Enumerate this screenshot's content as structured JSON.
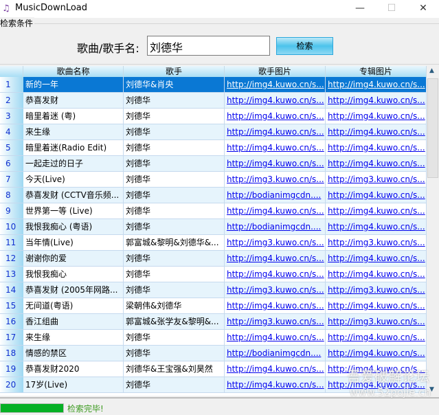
{
  "window": {
    "title": "MusicDownLoad",
    "minimize": "—",
    "maximize": "☐",
    "close": "✕"
  },
  "search": {
    "group_label": "检索条件",
    "label": "歌曲/歌手名:",
    "value": "刘德华",
    "button": "检索"
  },
  "table": {
    "columns": [
      "歌曲名称",
      "歌手",
      "歌手图片",
      "专辑图片"
    ],
    "selected_row": 1,
    "rows": [
      {
        "n": "1",
        "name": "新的一年",
        "artist": "刘德华&肖央",
        "singer_img": "http://img4.kuwo.cn/s...",
        "album_img": "http://img4.kuwo.cn/s..."
      },
      {
        "n": "2",
        "name": "恭喜发财",
        "artist": "刘德华",
        "singer_img": "http://img4.kuwo.cn/s...",
        "album_img": "http://img4.kuwo.cn/s..."
      },
      {
        "n": "3",
        "name": "暗里着迷 (粤)",
        "artist": "刘德华",
        "singer_img": "http://img4.kuwo.cn/s...",
        "album_img": "http://img4.kuwo.cn/s..."
      },
      {
        "n": "4",
        "name": "来生缘",
        "artist": "刘德华",
        "singer_img": "http://img4.kuwo.cn/s...",
        "album_img": "http://img4.kuwo.cn/s..."
      },
      {
        "n": "5",
        "name": "暗里着迷(Radio Edit)",
        "artist": "刘德华",
        "singer_img": "http://img4.kuwo.cn/s...",
        "album_img": "http://img4.kuwo.cn/s..."
      },
      {
        "n": "6",
        "name": "一起走过的日子",
        "artist": "刘德华",
        "singer_img": "http://img4.kuwo.cn/s...",
        "album_img": "http://img4.kuwo.cn/s..."
      },
      {
        "n": "7",
        "name": "今天(Live)",
        "artist": "刘德华",
        "singer_img": "http://img3.kuwo.cn/s...",
        "album_img": "http://img3.kuwo.cn/s..."
      },
      {
        "n": "8",
        "name": "恭喜发财 (CCTV音乐频...",
        "artist": "刘德华",
        "singer_img": "http://bodianimgcdn....",
        "album_img": "http://img4.kuwo.cn/s..."
      },
      {
        "n": "9",
        "name": "世界第一等 (Live)",
        "artist": "刘德华",
        "singer_img": "http://img4.kuwo.cn/s...",
        "album_img": "http://img4.kuwo.cn/s..."
      },
      {
        "n": "10",
        "name": "我恨我痴心 (粤语)",
        "artist": "刘德华",
        "singer_img": "http://bodianimgcdn....",
        "album_img": "http://img4.kuwo.cn/s..."
      },
      {
        "n": "11",
        "name": "当年情(Live)",
        "artist": "郭富城&黎明&刘德华&...",
        "singer_img": "http://img3.kuwo.cn/s...",
        "album_img": "http://img3.kuwo.cn/s..."
      },
      {
        "n": "12",
        "name": "谢谢你的爱",
        "artist": "刘德华",
        "singer_img": "http://img4.kuwo.cn/s...",
        "album_img": "http://img4.kuwo.cn/s..."
      },
      {
        "n": "13",
        "name": "我恨我痴心",
        "artist": "刘德华",
        "singer_img": "http://img4.kuwo.cn/s...",
        "album_img": "http://img4.kuwo.cn/s..."
      },
      {
        "n": "14",
        "name": "恭喜发财 (2005年网路...",
        "artist": "刘德华",
        "singer_img": "http://img3.kuwo.cn/s...",
        "album_img": "http://img3.kuwo.cn/s..."
      },
      {
        "n": "15",
        "name": "无间道(粤语)",
        "artist": "梁朝伟&刘德华",
        "singer_img": "http://img4.kuwo.cn/s...",
        "album_img": "http://img4.kuwo.cn/s..."
      },
      {
        "n": "16",
        "name": "香江组曲",
        "artist": "郭富城&张学友&黎明&...",
        "singer_img": "http://img3.kuwo.cn/s...",
        "album_img": "http://img3.kuwo.cn/s..."
      },
      {
        "n": "17",
        "name": "来生缘",
        "artist": "刘德华",
        "singer_img": "http://img4.kuwo.cn/s...",
        "album_img": "http://img4.kuwo.cn/s..."
      },
      {
        "n": "18",
        "name": "情感的禁区",
        "artist": "刘德华",
        "singer_img": "http://bodianimgcdn....",
        "album_img": "http://img4.kuwo.cn/s..."
      },
      {
        "n": "19",
        "name": "恭喜发财2020",
        "artist": "刘德华&王宝强&刘昊然",
        "singer_img": "http://img4.kuwo.cn/s...",
        "album_img": "http://img4.kuwo.cn/s..."
      },
      {
        "n": "20",
        "name": "17岁(Live)",
        "artist": "刘德华",
        "singer_img": "http://img4.kuwo.cn/s...",
        "album_img": "http://img4.kuwo.cn/s..."
      }
    ]
  },
  "status": {
    "progress_percent": 100,
    "text": "检索完毕!",
    "progress_color": "#06b025"
  },
  "watermark": {
    "line1": "吾爱破解论坛",
    "line2": "www.52pojie.cn"
  }
}
